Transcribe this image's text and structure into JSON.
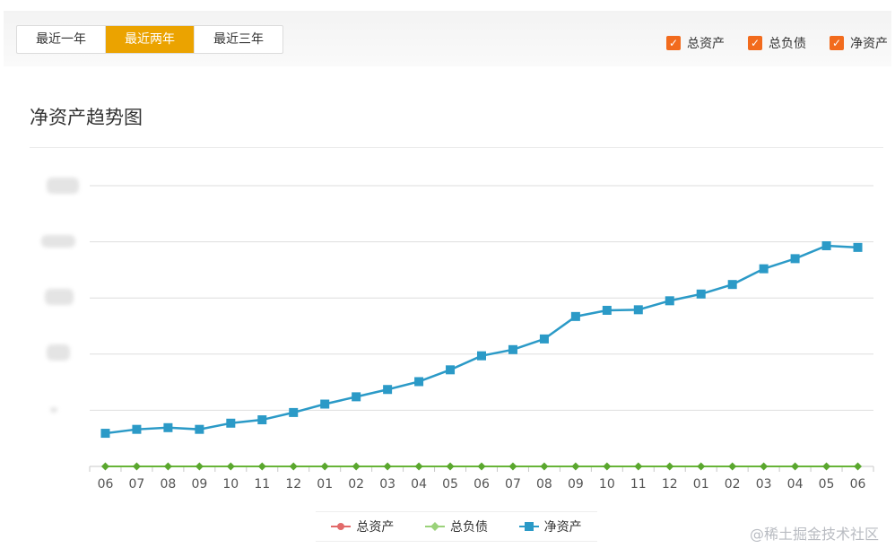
{
  "range_tabs": [
    {
      "label": "最近一年",
      "active": false
    },
    {
      "label": "最近两年",
      "active": true
    },
    {
      "label": "最近三年",
      "active": false
    }
  ],
  "toggles": [
    {
      "label": "总资产",
      "checked": true,
      "check_icon": "checkmark-icon"
    },
    {
      "label": "总负债",
      "checked": true,
      "check_icon": "checkmark-icon"
    },
    {
      "label": "净资产",
      "checked": true,
      "check_icon": "checkmark-icon"
    }
  ],
  "colors": {
    "accent": "#eba300",
    "checkbox": "#f26b1d",
    "net_assets": "#2b9ac7",
    "liabilities": "#67b438",
    "assets": "#e26a6a"
  },
  "watermark": "@稀土掘金技术社区",
  "chart_data": {
    "type": "line",
    "title": "净资产趋势图",
    "xlabel": "",
    "ylabel": "",
    "grid": true,
    "legend_position": "bottom",
    "categories": [
      "06",
      "07",
      "08",
      "09",
      "10",
      "11",
      "12",
      "01",
      "02",
      "03",
      "04",
      "05",
      "06",
      "07",
      "08",
      "09",
      "10",
      "11",
      "12",
      "01",
      "02",
      "03",
      "04",
      "05",
      "06"
    ],
    "ylim": [
      0,
      5
    ],
    "series": [
      {
        "name": "总资产",
        "marker": "circle",
        "color": "#e26a6a",
        "values": [
          0,
          0,
          0,
          0,
          0,
          0,
          0,
          0,
          0,
          0,
          0,
          0,
          0,
          0,
          0,
          0,
          0,
          0,
          0,
          0,
          0,
          0,
          0,
          0,
          0
        ]
      },
      {
        "name": "总负债",
        "marker": "diamond",
        "color": "#67b438",
        "values": [
          0,
          0,
          0,
          0,
          0,
          0,
          0,
          0,
          0,
          0,
          0,
          0,
          0,
          0,
          0,
          0,
          0,
          0,
          0,
          0,
          0,
          0,
          0,
          0,
          0
        ]
      },
      {
        "name": "净资产",
        "marker": "square",
        "color": "#2b9ac7",
        "values": [
          0.59,
          0.66,
          0.69,
          0.66,
          0.77,
          0.83,
          0.96,
          1.11,
          1.24,
          1.37,
          1.51,
          1.72,
          1.97,
          2.08,
          2.27,
          2.67,
          2.78,
          2.79,
          2.95,
          3.07,
          3.24,
          3.52,
          3.7,
          3.93,
          3.9
        ]
      }
    ]
  }
}
